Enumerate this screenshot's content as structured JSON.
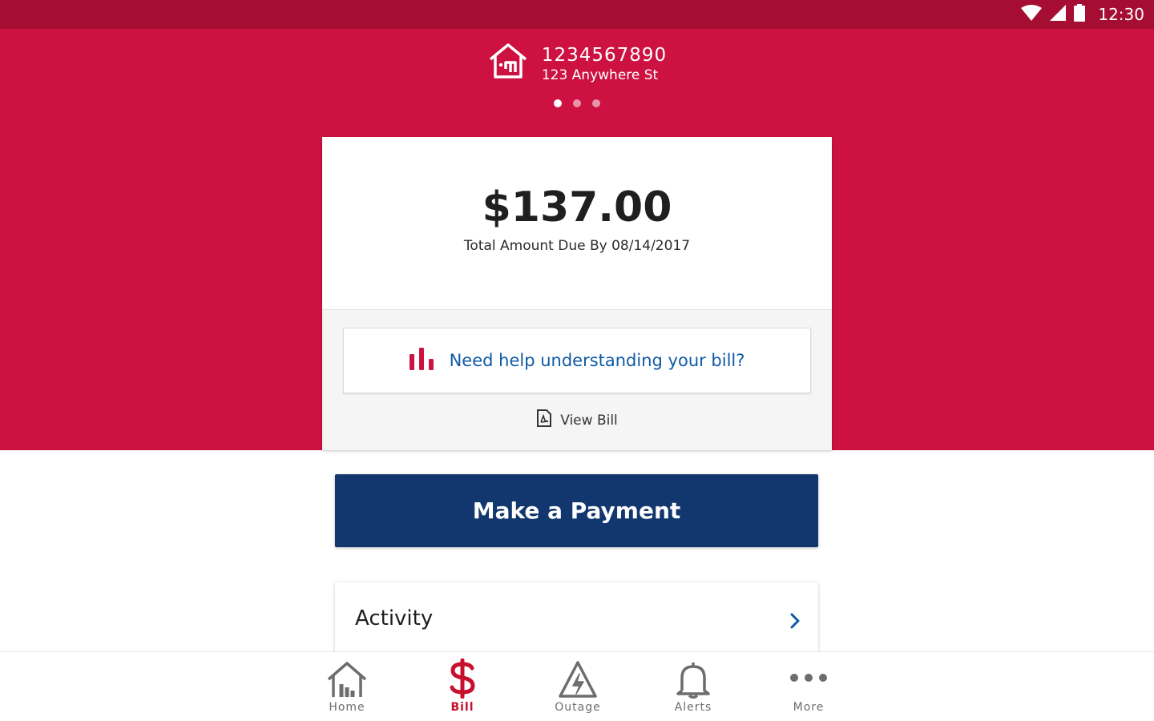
{
  "status_bar": {
    "time": "12:30"
  },
  "account": {
    "number": "1234567890",
    "address": "123 Anywhere St"
  },
  "pager": {
    "count": 3,
    "active": 1
  },
  "bill": {
    "amount": "$137.00",
    "due_text": "Total Amount Due By 08/14/2017",
    "help_link": "Need help understanding your bill?",
    "view_bill": "View Bill"
  },
  "payment": {
    "button_label": "Make a Payment"
  },
  "activity": {
    "label": "Activity"
  },
  "nav": {
    "items": [
      {
        "label": "Home",
        "icon": "home-icon"
      },
      {
        "label": "Bill",
        "icon": "dollar-icon",
        "active": true
      },
      {
        "label": "Outage",
        "icon": "outage-warning-icon"
      },
      {
        "label": "Alerts",
        "icon": "bell-icon"
      },
      {
        "label": "More",
        "icon": "more-dots-icon"
      }
    ]
  },
  "colors": {
    "brand_red": "#cd1141",
    "status_bar": "#a50d33",
    "button_navy": "#12376e",
    "link_blue": "#0f5aa6",
    "active_nav": "#c8102e"
  }
}
